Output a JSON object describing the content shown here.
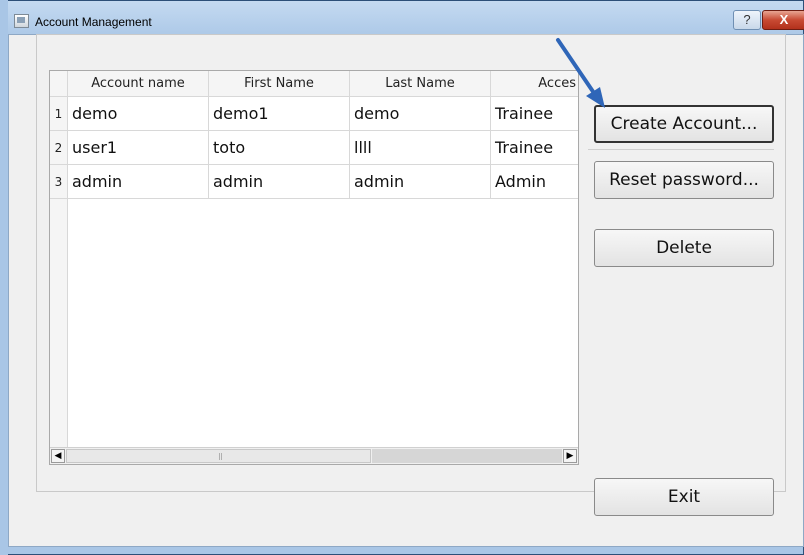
{
  "window": {
    "title": "Account Management",
    "help_label": "?",
    "close_label": "X"
  },
  "table": {
    "columns": [
      "Account name",
      "First Name",
      "Last Name",
      "Acces"
    ],
    "rows": [
      {
        "num": "1",
        "cells": [
          "demo",
          "demo1",
          "demo",
          "Trainee"
        ]
      },
      {
        "num": "2",
        "cells": [
          "user1",
          "toto",
          "llll",
          "Trainee"
        ]
      },
      {
        "num": "3",
        "cells": [
          "admin",
          "admin",
          "admin",
          "Admin"
        ]
      }
    ]
  },
  "buttons": {
    "create_account": "Create Account...",
    "reset_password": "Reset password...",
    "delete": "Delete",
    "exit": "Exit"
  },
  "scrollbar": {
    "left_arrow": "◀",
    "right_arrow": "▶"
  },
  "colors": {
    "annotation_arrow": "#2f66b8",
    "close_button": "#c84a33"
  },
  "icons": [
    "app-window-icon",
    "annotation-arrow-icon"
  ]
}
